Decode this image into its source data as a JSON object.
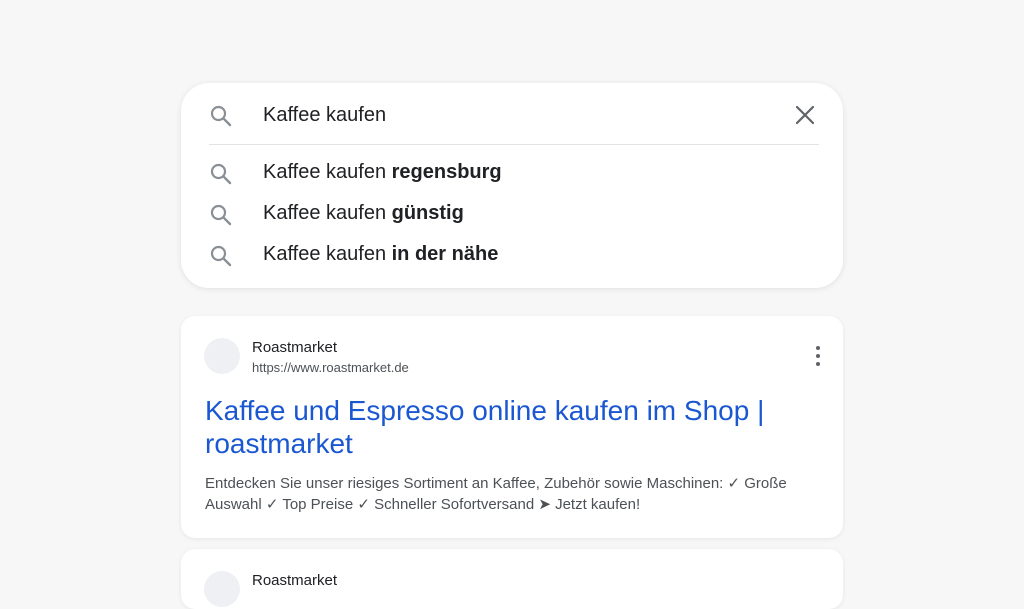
{
  "search": {
    "query": "Kaffee kaufen",
    "placeholder": ""
  },
  "suggestions": [
    {
      "prefix": "Kaffee kaufen ",
      "bold": "regensburg"
    },
    {
      "prefix": "Kaffee kaufen ",
      "bold": "günstig"
    },
    {
      "prefix": "Kaffee kaufen ",
      "bold": "in der nähe"
    }
  ],
  "results": [
    {
      "site_name": "Roastmarket",
      "url": "https://www.roastmarket.de",
      "title": "Kaffee und Espresso online kaufen im Shop | roastmarket",
      "snippet": "Entdecken Sie unser riesiges Sortiment an Kaffee, Zubehör sowie Maschinen: ✓ Große Auswahl ✓ Top Preise ✓ Schneller Sofortversand ➤ Jetzt kaufen!"
    },
    {
      "site_name": "Roastmarket"
    }
  ],
  "icons": {
    "search": "search-icon",
    "clear": "close-icon",
    "more": "more-vert-icon"
  },
  "colors": {
    "background": "#f7f7f7",
    "card": "#ffffff",
    "link": "#1a57d1",
    "icon": "#8a8f96",
    "text": "#202124",
    "secondary_text": "#4d5156"
  }
}
